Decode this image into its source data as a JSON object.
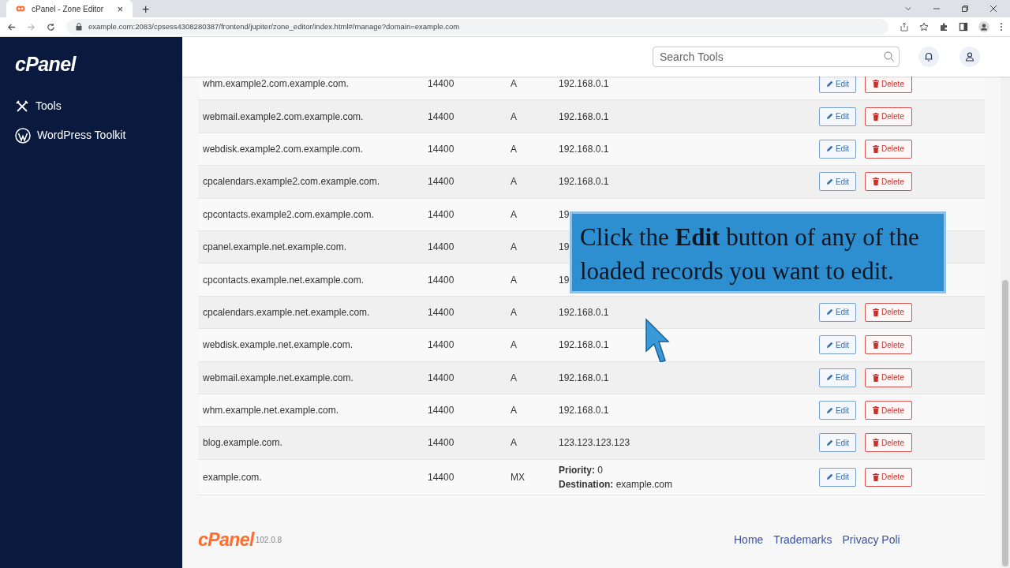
{
  "browser": {
    "tab_title": "cPanel - Zone Editor",
    "tab_close": "×",
    "new_tab": "+",
    "url": "example.com:2083/cpsess4308280387/frontend/jupiter/zone_editor/index.html#/manage?domain=example.com"
  },
  "sidebar": {
    "logo": "cPanel",
    "items": [
      {
        "label": "Tools",
        "kind": "tools"
      },
      {
        "label": "WordPress Toolkit",
        "kind": "wordpress"
      }
    ]
  },
  "header": {
    "search": {
      "placeholder": "Search Tools"
    }
  },
  "table": {
    "rows": [
      {
        "name": "whm.example2.com.example.com.",
        "ttl": "14400",
        "type": "A",
        "kind": "ip",
        "record": "192.168.0.1",
        "edit": "Edit",
        "delete": "Delete"
      },
      {
        "name": "webmail.example2.com.example.com.",
        "ttl": "14400",
        "type": "A",
        "kind": "ip",
        "record": "192.168.0.1",
        "edit": "Edit",
        "delete": "Delete"
      },
      {
        "name": "webdisk.example2.com.example.com.",
        "ttl": "14400",
        "type": "A",
        "kind": "ip",
        "record": "192.168.0.1",
        "edit": "Edit",
        "delete": "Delete"
      },
      {
        "name": "cpcalendars.example2.com.example.com.",
        "ttl": "14400",
        "type": "A",
        "kind": "ip",
        "record": "192.168.0.1",
        "edit": "Edit",
        "delete": "Delete"
      },
      {
        "name": "cpcontacts.example2.com.example.com.",
        "ttl": "14400",
        "type": "A",
        "kind": "ip",
        "record": "19"
      },
      {
        "name": "cpanel.example.net.example.com.",
        "ttl": "14400",
        "type": "A",
        "kind": "ip",
        "record": "19"
      },
      {
        "name": "cpcontacts.example.net.example.com.",
        "ttl": "14400",
        "type": "A",
        "kind": "ip",
        "record": "19"
      },
      {
        "name": "cpcalendars.example.net.example.com.",
        "ttl": "14400",
        "type": "A",
        "kind": "ip",
        "record": "192.168.0.1",
        "edit": "Edit",
        "delete": "Delete"
      },
      {
        "name": "webdisk.example.net.example.com.",
        "ttl": "14400",
        "type": "A",
        "kind": "ip",
        "record": "192.168.0.1",
        "edit": "Edit",
        "delete": "Delete"
      },
      {
        "name": "webmail.example.net.example.com.",
        "ttl": "14400",
        "type": "A",
        "kind": "ip",
        "record": "192.168.0.1",
        "edit": "Edit",
        "delete": "Delete"
      },
      {
        "name": "whm.example.net.example.com.",
        "ttl": "14400",
        "type": "A",
        "kind": "ip",
        "record": "192.168.0.1",
        "edit": "Edit",
        "delete": "Delete"
      },
      {
        "name": "blog.example.com.",
        "ttl": "14400",
        "type": "A",
        "kind": "ip",
        "record": "123.123.123.123",
        "edit": "Edit",
        "delete": "Delete"
      },
      {
        "name": "example.com.",
        "ttl": "14400",
        "type": "MX",
        "kind": "mx",
        "priority": "**Priority:** 0",
        "destination": "**Destination:** example.com",
        "edit": "Edit",
        "delete": "Delete"
      }
    ]
  },
  "callout": "Click the **Edit** button of any of the loaded records you want to edit.",
  "footer": {
    "logo": "cPanel",
    "version": "102.0.8",
    "links": [
      "Home",
      "Trademarks",
      "Privacy Poli"
    ]
  }
}
